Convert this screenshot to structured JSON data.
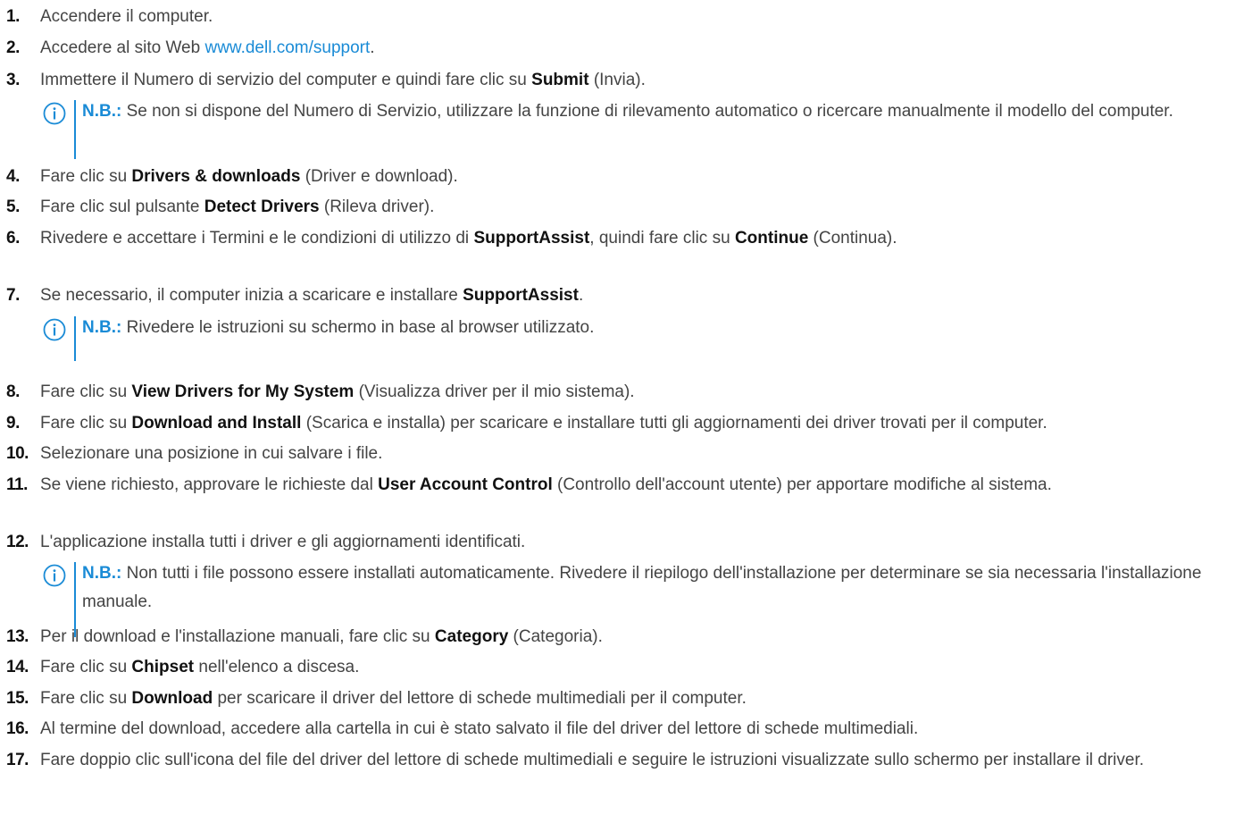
{
  "steps": [
    {
      "num": "1.",
      "parts": [
        {
          "t": "Accendere il computer."
        }
      ]
    },
    {
      "num": "2.",
      "parts": [
        {
          "t": "Accedere al sito Web "
        },
        {
          "t": "www.dell.com/support",
          "link": true
        },
        {
          "t": "."
        }
      ]
    },
    {
      "num": "3.",
      "parts": [
        {
          "t": "Immettere il Numero di servizio del computer e quindi fare clic su "
        },
        {
          "t": "Submit",
          "b": true
        },
        {
          "t": " (Invia)."
        }
      ]
    },
    {
      "num": "4.",
      "parts": [
        {
          "t": "Fare clic su "
        },
        {
          "t": "Drivers & downloads",
          "b": true
        },
        {
          "t": " (Driver e download)."
        }
      ]
    },
    {
      "num": "5.",
      "parts": [
        {
          "t": "Fare clic sul pulsante "
        },
        {
          "t": "Detect Drivers",
          "b": true
        },
        {
          "t": " (Rileva driver)."
        }
      ]
    },
    {
      "num": "6.",
      "parts": [
        {
          "t": "Rivedere e accettare i Termini e le condizioni di utilizzo di "
        },
        {
          "t": "SupportAssist",
          "b": true
        },
        {
          "t": ", quindi fare clic su "
        },
        {
          "t": "Continue",
          "b": true
        },
        {
          "t": " (Continua)."
        }
      ]
    },
    {
      "num": "7.",
      "parts": [
        {
          "t": "Se necessario, il computer inizia a scaricare e installare "
        },
        {
          "t": "SupportAssist",
          "b": true
        },
        {
          "t": "."
        }
      ]
    },
    {
      "num": "8.",
      "parts": [
        {
          "t": "Fare clic su "
        },
        {
          "t": "View Drivers for My System",
          "b": true
        },
        {
          "t": " (Visualizza driver per il mio sistema)."
        }
      ]
    },
    {
      "num": "9.",
      "parts": [
        {
          "t": "Fare clic su "
        },
        {
          "t": "Download and Install",
          "b": true
        },
        {
          "t": " (Scarica e installa) per scaricare e installare tutti gli aggiornamenti dei driver trovati per il computer."
        }
      ]
    },
    {
      "num": "10.",
      "parts": [
        {
          "t": "Selezionare una posizione in cui salvare i file."
        }
      ]
    },
    {
      "num": "11.",
      "parts": [
        {
          "t": "Se viene richiesto, approvare le richieste dal "
        },
        {
          "t": "User Account Control",
          "b": true
        },
        {
          "t": " (Controllo dell'account utente) per apportare modifiche al sistema."
        }
      ]
    },
    {
      "num": "12.",
      "parts": [
        {
          "t": "L'applicazione installa tutti i driver e gli aggiornamenti identificati."
        }
      ]
    },
    {
      "num": "13.",
      "parts": [
        {
          "t": "Per il download e l'installazione manuali, fare clic su "
        },
        {
          "t": "Category",
          "b": true
        },
        {
          "t": " (Categoria)."
        }
      ]
    },
    {
      "num": "14.",
      "parts": [
        {
          "t": "Fare clic su "
        },
        {
          "t": "Chipset",
          "b": true
        },
        {
          "t": " nell'elenco a discesa."
        }
      ]
    },
    {
      "num": "15.",
      "parts": [
        {
          "t": "Fare clic su "
        },
        {
          "t": "Download",
          "b": true
        },
        {
          "t": " per scaricare il driver del lettore di schede multimediali per il computer."
        }
      ]
    },
    {
      "num": "16.",
      "parts": [
        {
          "t": "Al termine del download, accedere alla cartella in cui è stato salvato il file del driver del lettore di schede multimediali."
        }
      ]
    },
    {
      "num": "17.",
      "parts": [
        {
          "t": "Fare doppio clic sull'icona del file del driver del lettore di schede multimediali e seguire le istruzioni visualizzate sullo schermo per installare il driver."
        }
      ]
    }
  ],
  "notes": [
    {
      "label": "N.B.:",
      "text": " Se non si dispone del Numero di Servizio, utilizzare la funzione di rilevamento automatico o ricercare manualmente il modello del computer."
    },
    {
      "label": "N.B.:",
      "text": " Rivedere le istruzioni su schermo in base al browser utilizzato."
    },
    {
      "label": "N.B.:",
      "text": " Non tutti i file possono essere installati automaticamente. Rivedere il riepilogo dell'installazione per determinare se sia necessaria l'installazione manuale."
    }
  ],
  "colors": {
    "text": "#444444",
    "accent": "#1a8bd6",
    "bold": "#111111"
  },
  "icons": {
    "note": "info-circle-icon"
  }
}
